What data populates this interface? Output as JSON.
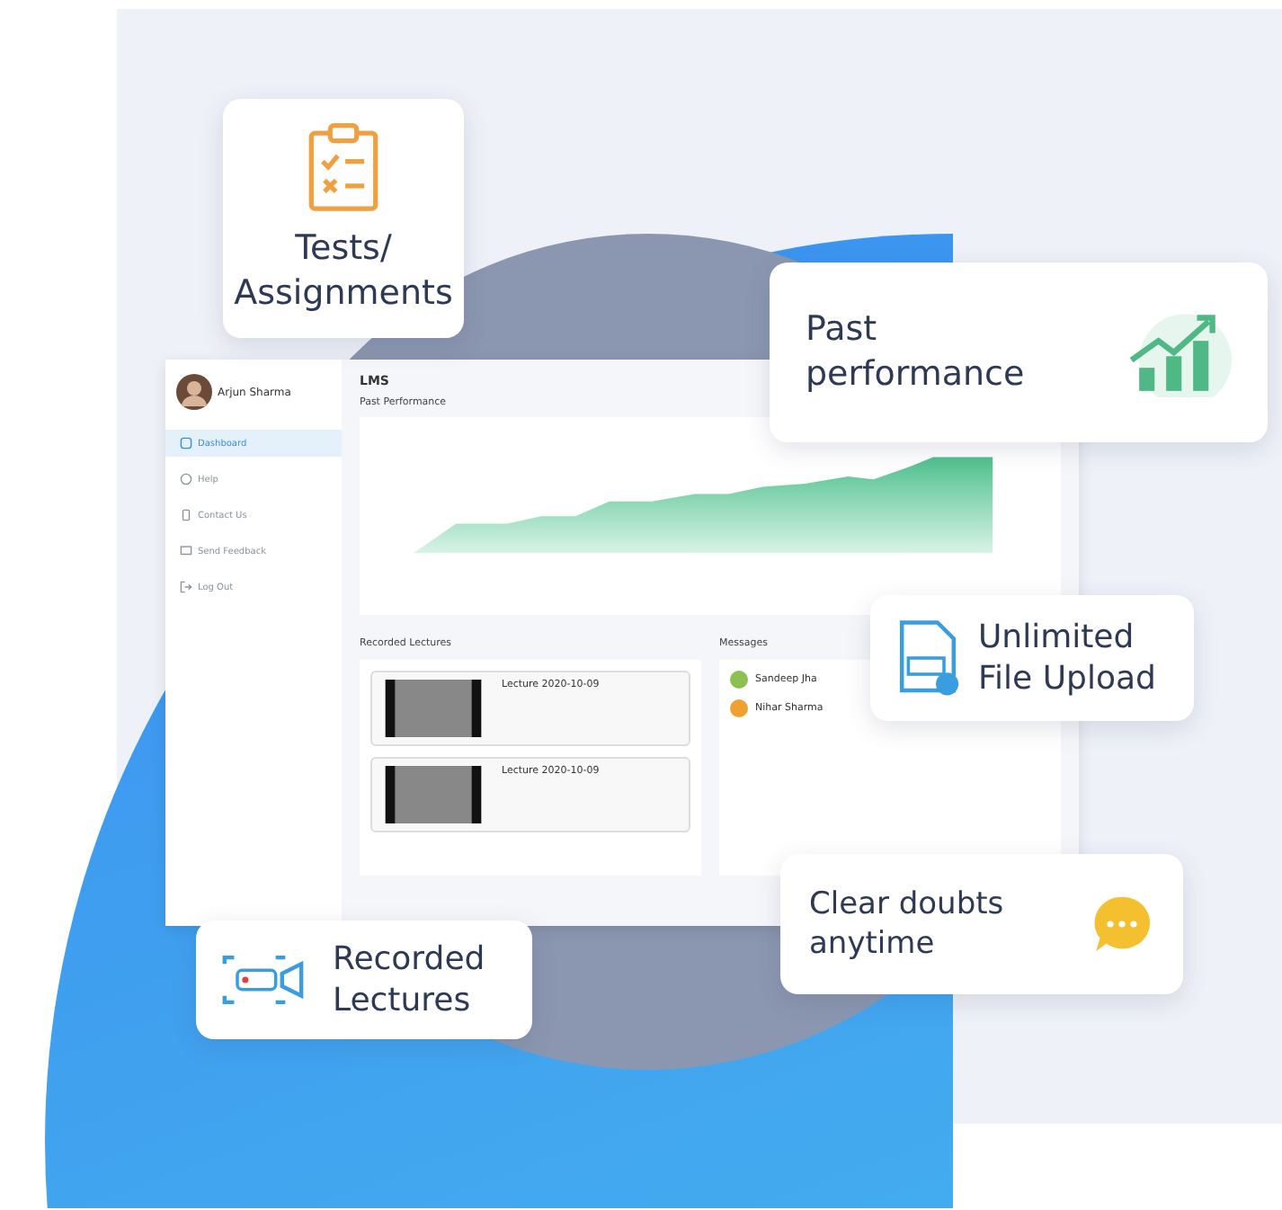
{
  "sidebar": {
    "user": {
      "name": "Arjun Sharma"
    },
    "items": [
      {
        "label": "Dashboard",
        "kind": "grid",
        "selected": true
      },
      {
        "label": "Help",
        "kind": "help",
        "selected": false
      },
      {
        "label": "Contact Us",
        "kind": "phone",
        "selected": false
      },
      {
        "label": "Send Feedback",
        "kind": "chat",
        "selected": false
      },
      {
        "label": "Log Out",
        "kind": "logout",
        "selected": false
      }
    ]
  },
  "header": {
    "title": "LMS"
  },
  "performance": {
    "title": "Past Performance"
  },
  "lectures": {
    "title": "Recorded Lectures",
    "items": [
      {
        "title": "Lecture 2020-10-09"
      },
      {
        "title": "Lecture 2020-10-09"
      }
    ]
  },
  "messages": {
    "title": "Messages",
    "items": [
      {
        "sender": "Sandeep Jha",
        "color": "#8cc152"
      },
      {
        "sender": "Nihar Sharma",
        "color": "#f0a030"
      }
    ]
  },
  "feature_cards": [
    {
      "kind": "tests",
      "lines": [
        "Tests/",
        "Assignments"
      ]
    },
    {
      "kind": "performance",
      "lines": [
        "Past",
        "performance"
      ]
    },
    {
      "kind": "upload",
      "lines": [
        "Unlimited",
        "File Upload"
      ]
    },
    {
      "kind": "doubts",
      "lines": [
        "Clear doubts",
        "anytime"
      ]
    },
    {
      "kind": "lectures",
      "lines": [
        "Recorded",
        "Lectures"
      ]
    }
  ]
}
